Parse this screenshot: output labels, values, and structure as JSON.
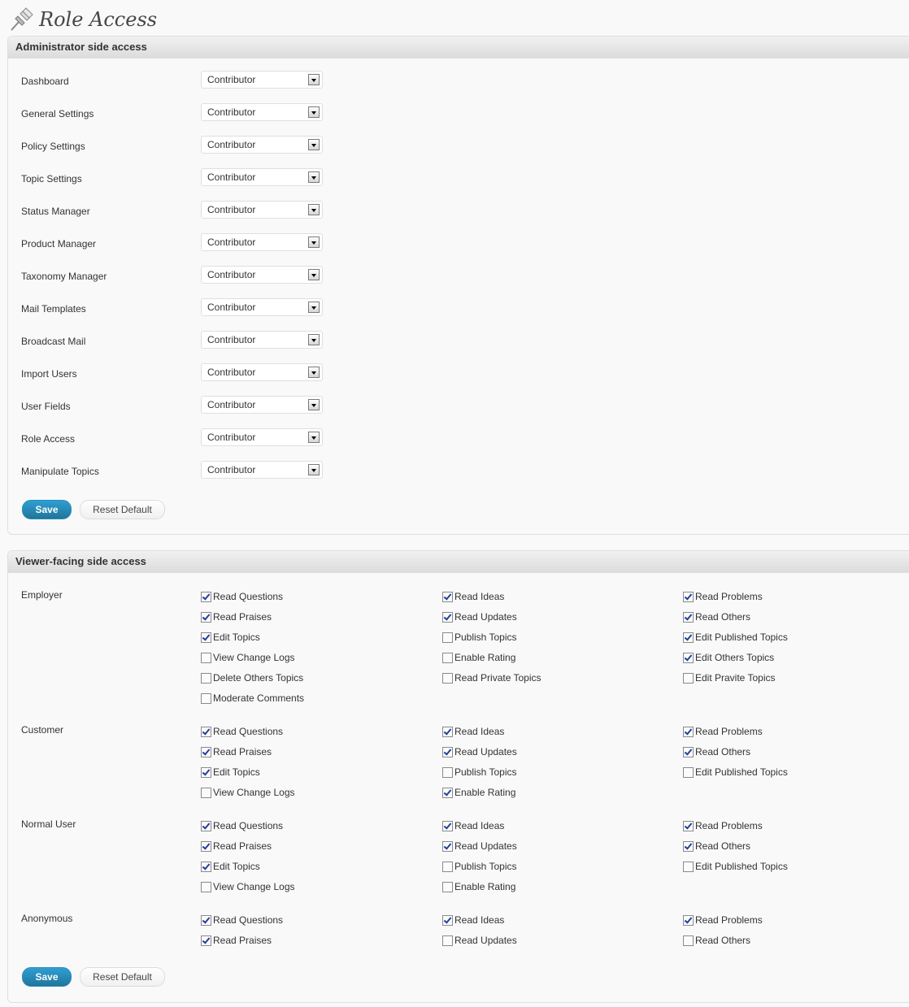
{
  "page": {
    "title": "Role Access"
  },
  "admin": {
    "heading": "Administrator side access",
    "rows": [
      {
        "label": "Dashboard",
        "value": "Contributor"
      },
      {
        "label": "General Settings",
        "value": "Contributor"
      },
      {
        "label": "Policy Settings",
        "value": "Contributor"
      },
      {
        "label": "Topic Settings",
        "value": "Contributor"
      },
      {
        "label": "Status Manager",
        "value": "Contributor"
      },
      {
        "label": "Product Manager",
        "value": "Contributor"
      },
      {
        "label": "Taxonomy Manager",
        "value": "Contributor"
      },
      {
        "label": "Mail Templates",
        "value": "Contributor"
      },
      {
        "label": "Broadcast Mail",
        "value": "Contributor"
      },
      {
        "label": "Import Users",
        "value": "Contributor"
      },
      {
        "label": "User Fields",
        "value": "Contributor"
      },
      {
        "label": "Role Access",
        "value": "Contributor"
      },
      {
        "label": "Manipulate Topics",
        "value": "Contributor"
      }
    ],
    "save_label": "Save",
    "reset_label": "Reset Default"
  },
  "viewer": {
    "heading": "Viewer-facing side access",
    "roles": [
      {
        "name": "Employer",
        "columns": [
          [
            {
              "label": "Read Questions",
              "checked": true
            },
            {
              "label": "Read Praises",
              "checked": true
            },
            {
              "label": "Edit Topics",
              "checked": true
            },
            {
              "label": "View Change Logs",
              "checked": false
            },
            {
              "label": "Delete Others Topics",
              "checked": false
            },
            {
              "label": "Moderate Comments",
              "checked": false
            }
          ],
          [
            {
              "label": "Read Ideas",
              "checked": true
            },
            {
              "label": "Read Updates",
              "checked": true
            },
            {
              "label": "Publish Topics",
              "checked": false
            },
            {
              "label": "Enable Rating",
              "checked": false
            },
            {
              "label": "Read Private Topics",
              "checked": false
            }
          ],
          [
            {
              "label": "Read Problems",
              "checked": true
            },
            {
              "label": "Read Others",
              "checked": true
            },
            {
              "label": "Edit Published Topics",
              "checked": true
            },
            {
              "label": "Edit Others Topics",
              "checked": true
            },
            {
              "label": "Edit Pravite Topics",
              "checked": false
            }
          ]
        ]
      },
      {
        "name": "Customer",
        "columns": [
          [
            {
              "label": "Read Questions",
              "checked": true
            },
            {
              "label": "Read Praises",
              "checked": true
            },
            {
              "label": "Edit Topics",
              "checked": true
            },
            {
              "label": "View Change Logs",
              "checked": false
            }
          ],
          [
            {
              "label": "Read Ideas",
              "checked": true
            },
            {
              "label": "Read Updates",
              "checked": true
            },
            {
              "label": "Publish Topics",
              "checked": false
            },
            {
              "label": "Enable Rating",
              "checked": true
            }
          ],
          [
            {
              "label": "Read Problems",
              "checked": true
            },
            {
              "label": "Read Others",
              "checked": true
            },
            {
              "label": "Edit Published Topics",
              "checked": false
            }
          ]
        ]
      },
      {
        "name": "Normal User",
        "columns": [
          [
            {
              "label": "Read Questions",
              "checked": true
            },
            {
              "label": "Read Praises",
              "checked": true
            },
            {
              "label": "Edit Topics",
              "checked": true
            },
            {
              "label": "View Change Logs",
              "checked": false
            }
          ],
          [
            {
              "label": "Read Ideas",
              "checked": true
            },
            {
              "label": "Read Updates",
              "checked": true
            },
            {
              "label": "Publish Topics",
              "checked": false
            },
            {
              "label": "Enable Rating",
              "checked": false
            }
          ],
          [
            {
              "label": "Read Problems",
              "checked": true
            },
            {
              "label": "Read Others",
              "checked": true
            },
            {
              "label": "Edit Published Topics",
              "checked": false
            }
          ]
        ]
      },
      {
        "name": "Anonymous",
        "columns": [
          [
            {
              "label": "Read Questions",
              "checked": true
            },
            {
              "label": "Read Praises",
              "checked": true
            }
          ],
          [
            {
              "label": "Read Ideas",
              "checked": true
            },
            {
              "label": "Read Updates",
              "checked": false
            }
          ],
          [
            {
              "label": "Read Problems",
              "checked": true
            },
            {
              "label": "Read Others",
              "checked": false
            }
          ]
        ]
      }
    ],
    "save_label": "Save",
    "reset_label": "Reset Default"
  },
  "icons": {
    "header_icon": "pushpin-icon",
    "dropdown_icon": "chevron-down-icon"
  },
  "colors": {
    "primary_button": "#21759b",
    "checkmark": "#21409a"
  }
}
